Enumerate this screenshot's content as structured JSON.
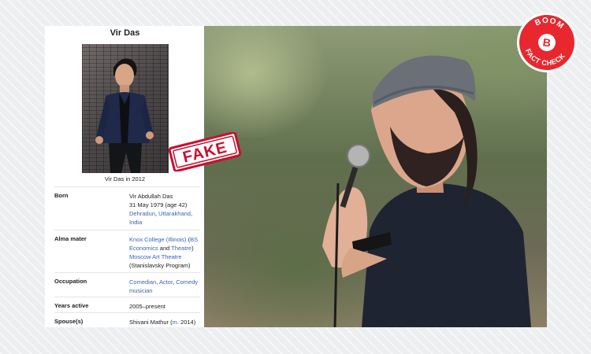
{
  "infobox": {
    "title": "Vir Das",
    "caption": "Vir Das in 2012",
    "rows": [
      {
        "label": "Born",
        "lines": [
          {
            "segments": [
              {
                "text": "Vir Abdullah Das",
                "link": false
              }
            ]
          },
          {
            "segments": [
              {
                "text": "31 May 1979 (age 42)",
                "link": false
              }
            ]
          },
          {
            "segments": [
              {
                "text": "Dehradun",
                "link": true
              },
              {
                "text": ", ",
                "link": false
              },
              {
                "text": "Uttarakhand",
                "link": true
              },
              {
                "text": ",",
                "link": false
              }
            ]
          },
          {
            "segments": [
              {
                "text": "India",
                "link": true
              }
            ]
          }
        ]
      },
      {
        "label": "Alma mater",
        "lines": [
          {
            "segments": [
              {
                "text": "Knox College (Illinois)",
                "link": true
              },
              {
                "text": " (",
                "link": false
              },
              {
                "text": "BS",
                "link": true
              }
            ]
          },
          {
            "segments": [
              {
                "text": "Economics",
                "link": true
              },
              {
                "text": " and ",
                "link": false
              },
              {
                "text": "Theatre",
                "link": true
              },
              {
                "text": ")",
                "link": false
              }
            ]
          },
          {
            "segments": [
              {
                "text": "Moscow Art Theatre",
                "link": true
              }
            ]
          },
          {
            "segments": [
              {
                "text": "(Stanislavsky Program)",
                "link": false
              }
            ]
          }
        ]
      },
      {
        "label": "Occupation",
        "lines": [
          {
            "segments": [
              {
                "text": "Comedian",
                "link": true
              },
              {
                "text": ", ",
                "link": false
              },
              {
                "text": "Actor",
                "link": true
              },
              {
                "text": ", ",
                "link": false
              },
              {
                "text": "Comedy",
                "link": true
              }
            ]
          },
          {
            "segments": [
              {
                "text": "musician",
                "link": true
              }
            ]
          }
        ]
      },
      {
        "label": "Years active",
        "lines": [
          {
            "segments": [
              {
                "text": "2005–present",
                "link": false
              }
            ]
          }
        ]
      },
      {
        "label": "Spouse(s)",
        "lines": [
          {
            "segments": [
              {
                "text": "Shivani Mathur (",
                "link": false
              },
              {
                "text": "m.",
                "link": true
              },
              {
                "text": " 2014)",
                "link": false
              }
            ]
          }
        ]
      }
    ]
  },
  "stamp": {
    "text": "FAKE",
    "color": "#c8102e"
  },
  "badge": {
    "top_text": "BOOM",
    "letter": "B",
    "bottom_text": "FACT CHECK",
    "color": "#e8272f"
  }
}
